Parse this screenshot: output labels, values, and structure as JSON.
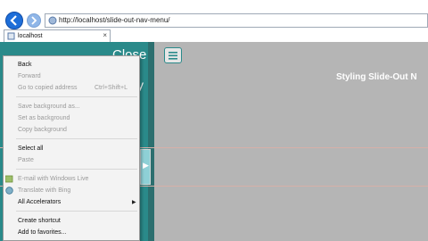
{
  "browser": {
    "address": "http://localhost/slide-out-nav-menu/",
    "tab_title": "localhost",
    "tab_close": "×"
  },
  "page": {
    "sidebar_close_label": "Close",
    "sidebar_fragment": "y",
    "title": "Styling Slide-Out N"
  },
  "context_menu": {
    "items": [
      {
        "label": "Back",
        "disabled": false
      },
      {
        "label": "Forward",
        "disabled": true
      },
      {
        "label": "Go to copied address",
        "disabled": true,
        "shortcut": "Ctrl+Shift+L"
      },
      {
        "label": "Save background as...",
        "disabled": true
      },
      {
        "label": "Set as background",
        "disabled": true
      },
      {
        "label": "Copy background",
        "disabled": true
      },
      {
        "label": "Select all",
        "disabled": false
      },
      {
        "label": "Paste",
        "disabled": true
      },
      {
        "label": "E-mail with Windows Live",
        "disabled": true
      },
      {
        "label": "Translate with Bing",
        "disabled": true
      },
      {
        "label": "All Accelerators",
        "disabled": false
      },
      {
        "label": "Create shortcut",
        "disabled": false
      },
      {
        "label": "Add to favorites...",
        "disabled": false
      }
    ]
  },
  "colors": {
    "sidebar": "#2a8a8a",
    "page_bg": "#b5b5b5",
    "menu_bg": "#f3f3f3"
  }
}
